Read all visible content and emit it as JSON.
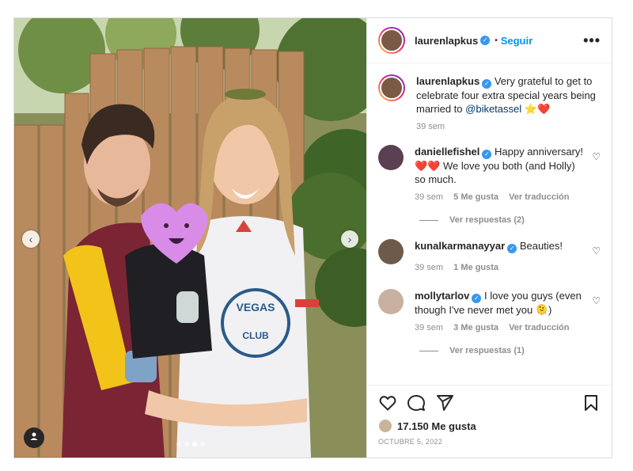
{
  "post": {
    "author": "laurenlapkus",
    "follow_label": "Seguir",
    "more_label": "•••",
    "caption": {
      "user": "laurenlapkus",
      "text_before": "Very grateful to get to celebrate four extra special years being married to ",
      "mention": "@biketassel",
      "emojis": "⭐❤️",
      "time": "39 sem"
    },
    "likes_label": "17.150 Me gusta",
    "date": "OCTUBRE 5, 2022"
  },
  "comments": [
    {
      "user": "daniellefishel",
      "verified": true,
      "text": "Happy anniversary! ❤️❤️ We love you both (and Holly) so much.",
      "time": "39 sem",
      "likes": "5 Me gusta",
      "translate": "Ver traducción",
      "replies": "Ver respuestas (2)"
    },
    {
      "user": "kunalkarmanayyar",
      "verified": true,
      "text": "Beauties!",
      "time": "39 sem",
      "likes": "1 Me gusta"
    },
    {
      "user": "mollytarlov",
      "verified": true,
      "text": "I love you guys (even though I've never met you 🫠)",
      "time": "39 sem",
      "likes": "3 Me gusta",
      "translate": "Ver traducción",
      "replies": "Ver respuestas (1)"
    }
  ],
  "photo": {
    "nav_prev": "‹",
    "nav_next": "›",
    "carousel_count": 4,
    "carousel_active": 3,
    "shirt_text": "VEGAS CLUB"
  },
  "colors": {
    "accent": "#0095f6",
    "verified": "#3897f0",
    "muted": "#8e8e8e"
  }
}
